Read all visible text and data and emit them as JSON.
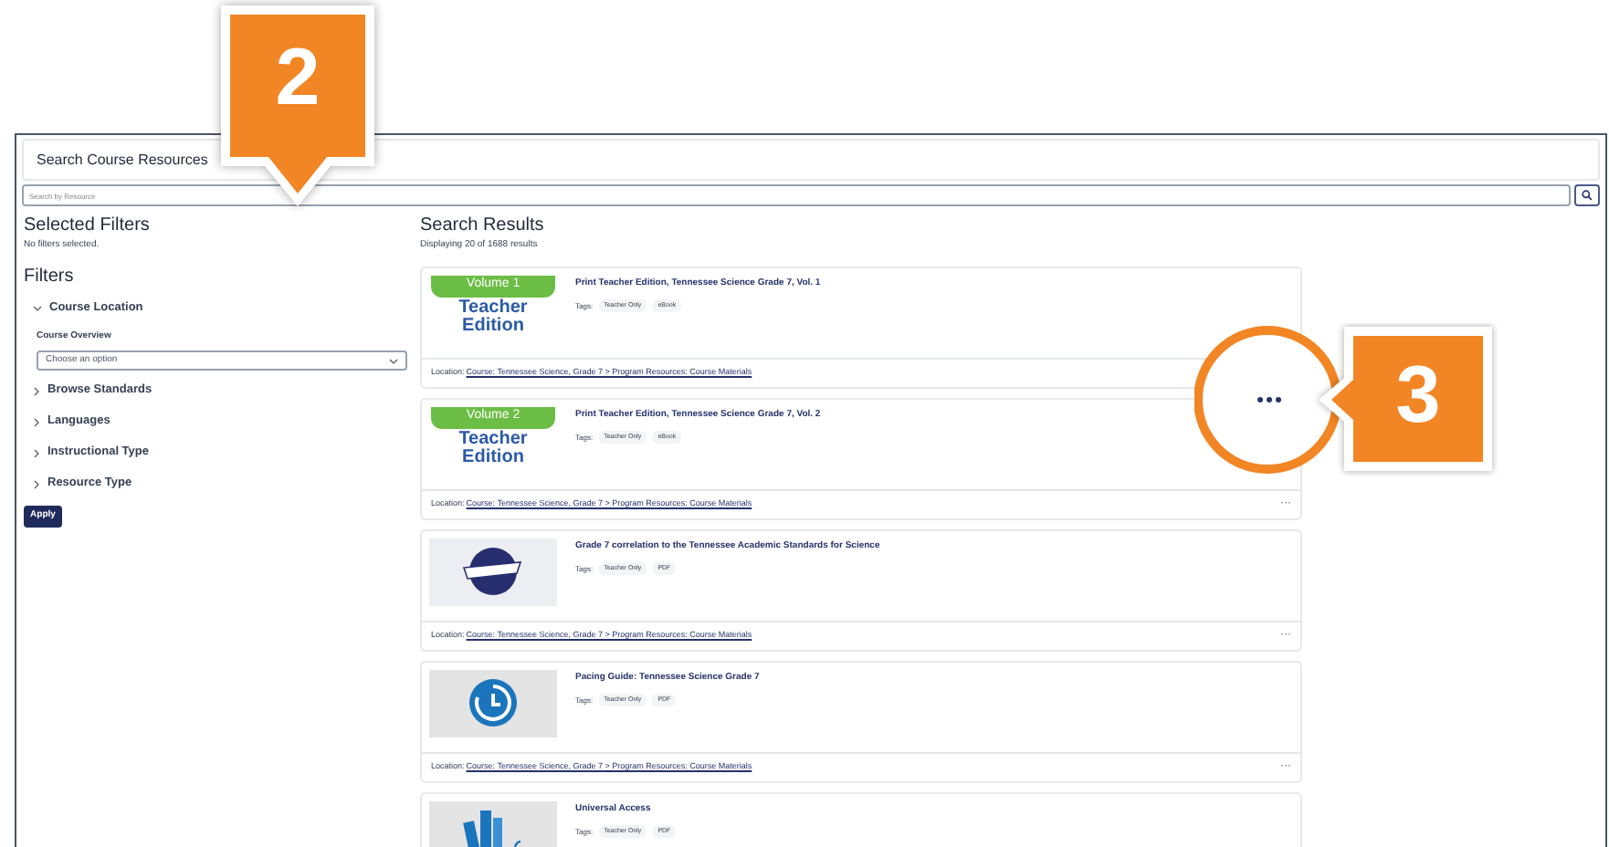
{
  "window": {
    "title": "Search Course Resources"
  },
  "search": {
    "placeholder": "Search by Resource"
  },
  "selected_filters": {
    "heading": "Selected Filters",
    "empty_text": "No filters selected."
  },
  "filters": {
    "heading": "Filters",
    "groups": [
      {
        "label": "Course Location",
        "expanded": true,
        "field_label": "Course Overview",
        "select_placeholder": "Choose an option"
      },
      {
        "label": "Browse Standards",
        "expanded": false
      },
      {
        "label": "Languages",
        "expanded": false
      },
      {
        "label": "Instructional Type",
        "expanded": false
      },
      {
        "label": "Resource Type",
        "expanded": false
      }
    ],
    "apply_button": "Apply"
  },
  "results": {
    "heading": "Search Results",
    "summary": "Displaying 20 of 1688 results",
    "items": [
      {
        "thumbnail": {
          "kind": "teacher-edition",
          "banner": "Volume 1",
          "caption": "Teacher Edition"
        },
        "title": "Print Teacher Edition, Tennessee Science Grade 7, Vol. 1",
        "tags_label": "Tags:",
        "tags": [
          "Teacher Only",
          "eBook"
        ],
        "location_label": "Location:",
        "location": "Course: Tennessee Science, Grade 7 > Program Resources: Course Materials"
      },
      {
        "thumbnail": {
          "kind": "teacher-edition",
          "banner": "Volume 2",
          "caption": "Teacher Edition"
        },
        "title": "Print Teacher Edition, Tennessee Science Grade 7, Vol. 2",
        "tags_label": "Tags:",
        "tags": [
          "Teacher Only",
          "eBook"
        ],
        "location_label": "Location:",
        "location": "Course: Tennessee Science, Grade 7 > Program Resources: Course Materials",
        "menu": "···"
      },
      {
        "thumbnail": {
          "kind": "state-logo"
        },
        "title": "Grade 7 correlation to the Tennessee Academic Standards for Science",
        "tags_label": "Tags:",
        "tags": [
          "Teacher Only",
          "PDF"
        ],
        "location_label": "Location:",
        "location": "Course: Tennessee Science, Grade 7 > Program Resources: Course Materials",
        "menu": "···"
      },
      {
        "thumbnail": {
          "kind": "clock"
        },
        "title": "Pacing Guide: Tennessee Science Grade 7",
        "tags_label": "Tags:",
        "tags": [
          "Teacher Only",
          "PDF"
        ],
        "location_label": "Location:",
        "location": "Course: Tennessee Science, Grade 7 > Program Resources: Course Materials",
        "menu": "···"
      },
      {
        "thumbnail": {
          "kind": "books"
        },
        "title": "Universal Access",
        "tags_label": "Tags:",
        "tags": [
          "Teacher Only",
          "PDF"
        ]
      }
    ]
  },
  "callouts": [
    {
      "number": "2"
    },
    {
      "number": "3"
    }
  ]
}
